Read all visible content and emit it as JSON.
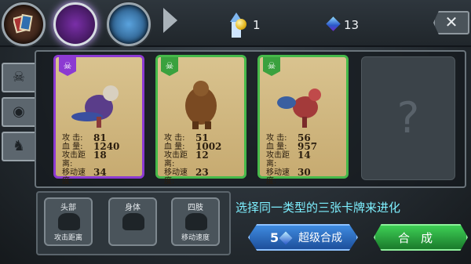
{
  "currency": {
    "coins": "1",
    "gems": "13"
  },
  "cards": [
    {
      "rarity_color": "#8c3ad2",
      "stats": {
        "attack_label": "攻  击:",
        "attack": "81",
        "hp_label": "血  量:",
        "hp": "1240",
        "range_label": "攻击距离:",
        "range": "18",
        "speed_label": "移动速度:",
        "speed": "34"
      }
    },
    {
      "rarity_color": "#46b94a",
      "stats": {
        "attack_label": "攻  击:",
        "attack": "51",
        "hp_label": "血  量:",
        "hp": "1002",
        "range_label": "攻击距离:",
        "range": "12",
        "speed_label": "移动速度:",
        "speed": "23"
      }
    },
    {
      "rarity_color": "#46b94a",
      "stats": {
        "attack_label": "攻  击:",
        "attack": "56",
        "hp_label": "血  量:",
        "hp": "957",
        "range_label": "攻击距离:",
        "range": "14",
        "speed_label": "移动速度:",
        "speed": "30"
      }
    }
  ],
  "empty_slot": {
    "symbol": "?"
  },
  "parts": [
    {
      "top": "头部",
      "bottom": "攻击距离"
    },
    {
      "top": "身体",
      "bottom": ""
    },
    {
      "top": "四肢",
      "bottom": "移动速度"
    }
  ],
  "hint": "选择同一类型的三张卡牌来进化",
  "super_button": {
    "count": "5",
    "label": "超级合成"
  },
  "merge_button": {
    "label": "合成"
  },
  "close_symbol": "✕"
}
